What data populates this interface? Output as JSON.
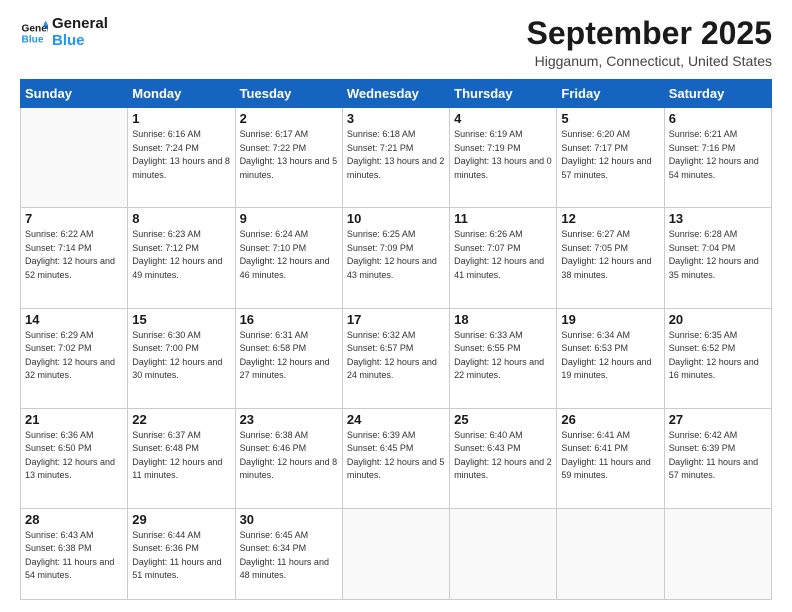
{
  "logo": {
    "line1": "General",
    "line2": "Blue"
  },
  "title": "September 2025",
  "location": "Higganum, Connecticut, United States",
  "days_header": [
    "Sunday",
    "Monday",
    "Tuesday",
    "Wednesday",
    "Thursday",
    "Friday",
    "Saturday"
  ],
  "weeks": [
    [
      {
        "num": "",
        "sunrise": "",
        "sunset": "",
        "daylight": ""
      },
      {
        "num": "1",
        "sunrise": "6:16 AM",
        "sunset": "7:24 PM",
        "daylight": "13 hours and 8 minutes."
      },
      {
        "num": "2",
        "sunrise": "6:17 AM",
        "sunset": "7:22 PM",
        "daylight": "13 hours and 5 minutes."
      },
      {
        "num": "3",
        "sunrise": "6:18 AM",
        "sunset": "7:21 PM",
        "daylight": "13 hours and 2 minutes."
      },
      {
        "num": "4",
        "sunrise": "6:19 AM",
        "sunset": "7:19 PM",
        "daylight": "13 hours and 0 minutes."
      },
      {
        "num": "5",
        "sunrise": "6:20 AM",
        "sunset": "7:17 PM",
        "daylight": "12 hours and 57 minutes."
      },
      {
        "num": "6",
        "sunrise": "6:21 AM",
        "sunset": "7:16 PM",
        "daylight": "12 hours and 54 minutes."
      }
    ],
    [
      {
        "num": "7",
        "sunrise": "6:22 AM",
        "sunset": "7:14 PM",
        "daylight": "12 hours and 52 minutes."
      },
      {
        "num": "8",
        "sunrise": "6:23 AM",
        "sunset": "7:12 PM",
        "daylight": "12 hours and 49 minutes."
      },
      {
        "num": "9",
        "sunrise": "6:24 AM",
        "sunset": "7:10 PM",
        "daylight": "12 hours and 46 minutes."
      },
      {
        "num": "10",
        "sunrise": "6:25 AM",
        "sunset": "7:09 PM",
        "daylight": "12 hours and 43 minutes."
      },
      {
        "num": "11",
        "sunrise": "6:26 AM",
        "sunset": "7:07 PM",
        "daylight": "12 hours and 41 minutes."
      },
      {
        "num": "12",
        "sunrise": "6:27 AM",
        "sunset": "7:05 PM",
        "daylight": "12 hours and 38 minutes."
      },
      {
        "num": "13",
        "sunrise": "6:28 AM",
        "sunset": "7:04 PM",
        "daylight": "12 hours and 35 minutes."
      }
    ],
    [
      {
        "num": "14",
        "sunrise": "6:29 AM",
        "sunset": "7:02 PM",
        "daylight": "12 hours and 32 minutes."
      },
      {
        "num": "15",
        "sunrise": "6:30 AM",
        "sunset": "7:00 PM",
        "daylight": "12 hours and 30 minutes."
      },
      {
        "num": "16",
        "sunrise": "6:31 AM",
        "sunset": "6:58 PM",
        "daylight": "12 hours and 27 minutes."
      },
      {
        "num": "17",
        "sunrise": "6:32 AM",
        "sunset": "6:57 PM",
        "daylight": "12 hours and 24 minutes."
      },
      {
        "num": "18",
        "sunrise": "6:33 AM",
        "sunset": "6:55 PM",
        "daylight": "12 hours and 22 minutes."
      },
      {
        "num": "19",
        "sunrise": "6:34 AM",
        "sunset": "6:53 PM",
        "daylight": "12 hours and 19 minutes."
      },
      {
        "num": "20",
        "sunrise": "6:35 AM",
        "sunset": "6:52 PM",
        "daylight": "12 hours and 16 minutes."
      }
    ],
    [
      {
        "num": "21",
        "sunrise": "6:36 AM",
        "sunset": "6:50 PM",
        "daylight": "12 hours and 13 minutes."
      },
      {
        "num": "22",
        "sunrise": "6:37 AM",
        "sunset": "6:48 PM",
        "daylight": "12 hours and 11 minutes."
      },
      {
        "num": "23",
        "sunrise": "6:38 AM",
        "sunset": "6:46 PM",
        "daylight": "12 hours and 8 minutes."
      },
      {
        "num": "24",
        "sunrise": "6:39 AM",
        "sunset": "6:45 PM",
        "daylight": "12 hours and 5 minutes."
      },
      {
        "num": "25",
        "sunrise": "6:40 AM",
        "sunset": "6:43 PM",
        "daylight": "12 hours and 2 minutes."
      },
      {
        "num": "26",
        "sunrise": "6:41 AM",
        "sunset": "6:41 PM",
        "daylight": "11 hours and 59 minutes."
      },
      {
        "num": "27",
        "sunrise": "6:42 AM",
        "sunset": "6:39 PM",
        "daylight": "11 hours and 57 minutes."
      }
    ],
    [
      {
        "num": "28",
        "sunrise": "6:43 AM",
        "sunset": "6:38 PM",
        "daylight": "11 hours and 54 minutes."
      },
      {
        "num": "29",
        "sunrise": "6:44 AM",
        "sunset": "6:36 PM",
        "daylight": "11 hours and 51 minutes."
      },
      {
        "num": "30",
        "sunrise": "6:45 AM",
        "sunset": "6:34 PM",
        "daylight": "11 hours and 48 minutes."
      },
      {
        "num": "",
        "sunrise": "",
        "sunset": "",
        "daylight": ""
      },
      {
        "num": "",
        "sunrise": "",
        "sunset": "",
        "daylight": ""
      },
      {
        "num": "",
        "sunrise": "",
        "sunset": "",
        "daylight": ""
      },
      {
        "num": "",
        "sunrise": "",
        "sunset": "",
        "daylight": ""
      }
    ]
  ],
  "labels": {
    "sunrise_prefix": "Sunrise: ",
    "sunset_prefix": "Sunset: ",
    "daylight_prefix": "Daylight: "
  }
}
